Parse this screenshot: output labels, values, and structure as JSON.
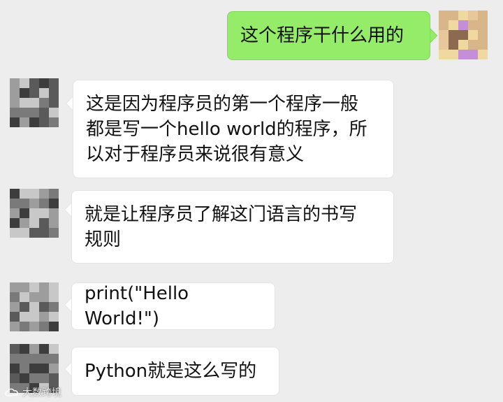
{
  "messages": [
    {
      "side": "right",
      "text": "这个程序干什么用的"
    },
    {
      "side": "left",
      "text": "这是因为程序员的第一个程序一般\n都是写一个hello world的程序，所\n以对于程序员来说很有意义"
    },
    {
      "side": "left",
      "text": "就是让程序员了解这门语言的书写\n规则"
    },
    {
      "side": "left",
      "text": "print(\"Hello World!\")"
    },
    {
      "side": "left",
      "text": "Python就是这么写的"
    }
  ],
  "watermark": {
    "text": "大数跨境",
    "icon": "cloud-logo-icon"
  },
  "colors": {
    "background": "#ededed",
    "sent_bubble": "#95ec69",
    "received_bubble": "#ffffff",
    "self_avatar_palette": [
      "#f0d9a0",
      "#e8c79a",
      "#d9b58a",
      "#8c6a4f",
      "#c48fd6"
    ],
    "other_avatar_palette": [
      "#3d3d3d",
      "#5a5a5a",
      "#7a7a7a",
      "#9d9d9d",
      "#c8c8c8"
    ]
  }
}
